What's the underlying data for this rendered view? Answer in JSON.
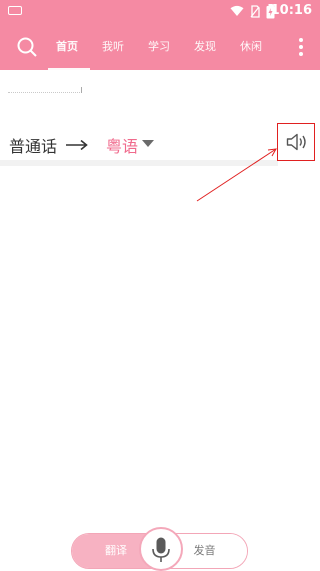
{
  "status_bar": {
    "time": "10:16"
  },
  "app_bar": {
    "tabs": [
      {
        "label": "首页"
      },
      {
        "label": "我听"
      },
      {
        "label": "学习"
      },
      {
        "label": "发现"
      },
      {
        "label": "休闲"
      }
    ],
    "active_tab_index": 0
  },
  "translator": {
    "source_language": "普通话",
    "target_language": "粤语"
  },
  "bottom_bar": {
    "translate_label": "翻译",
    "pronounce_label": "发音"
  },
  "colors": {
    "brand": "#f58aa3",
    "accent_text": "#f06a8c",
    "highlight_box": "#e02020"
  },
  "icons": [
    "keyboard-icon",
    "wifi-icon",
    "no-sim-icon",
    "battery-icon",
    "search-icon",
    "more-icon",
    "arrow-right-icon",
    "dropdown-caret-icon",
    "speaker-icon",
    "microphone-icon"
  ]
}
